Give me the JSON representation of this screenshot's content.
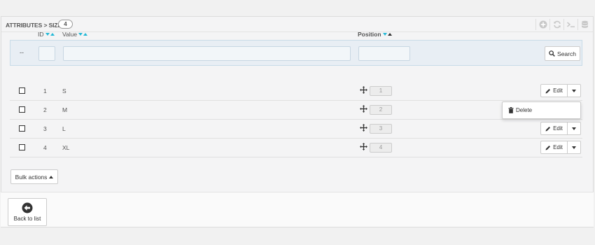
{
  "header": {
    "title": "ATTRIBUTES > SIZE",
    "count": "4",
    "toolbar_icons": [
      "add-icon",
      "refresh-icon",
      "terminal-icon",
      "database-icon"
    ]
  },
  "table": {
    "columns": {
      "id": "ID",
      "value": "Value",
      "position": "Position"
    },
    "filter": {
      "dash": "--",
      "search_label": "Search"
    },
    "rows": [
      {
        "id": "1",
        "value": "S",
        "position": "1",
        "edit_label": "Edit"
      },
      {
        "id": "2",
        "value": "M",
        "position": "2",
        "edit_label": "Edit"
      },
      {
        "id": "3",
        "value": "L",
        "position": "3",
        "edit_label": "Edit"
      },
      {
        "id": "4",
        "value": "XL",
        "position": "4",
        "edit_label": "Edit"
      }
    ],
    "dropdown": {
      "delete_label": "Delete"
    }
  },
  "bulk": {
    "label": "Bulk actions"
  },
  "footer": {
    "back_label": "Back to list"
  },
  "colors": {
    "accent": "#25b9d7",
    "filter_bg": "#e8eef4"
  }
}
